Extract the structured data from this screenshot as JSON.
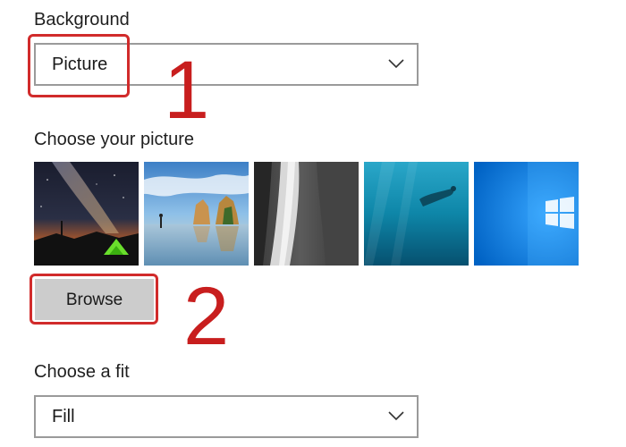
{
  "background": {
    "label": "Background",
    "selected": "Picture"
  },
  "picture": {
    "label": "Choose your picture",
    "thumbnails": [
      {
        "name": "milky-way-tent"
      },
      {
        "name": "beach-rocks"
      },
      {
        "name": "rock-waterfall"
      },
      {
        "name": "underwater-swimmer"
      },
      {
        "name": "windows-logo"
      }
    ],
    "browse_label": "Browse"
  },
  "fit": {
    "label": "Choose a fit",
    "selected": "Fill"
  },
  "annotations": {
    "step1": "1",
    "step2": "2"
  },
  "colors": {
    "annotation": "#d12b2b",
    "dropdown_border": "#9a9a9a",
    "button_bg": "#cccccc",
    "windows_blue": "#0a7ad8"
  }
}
